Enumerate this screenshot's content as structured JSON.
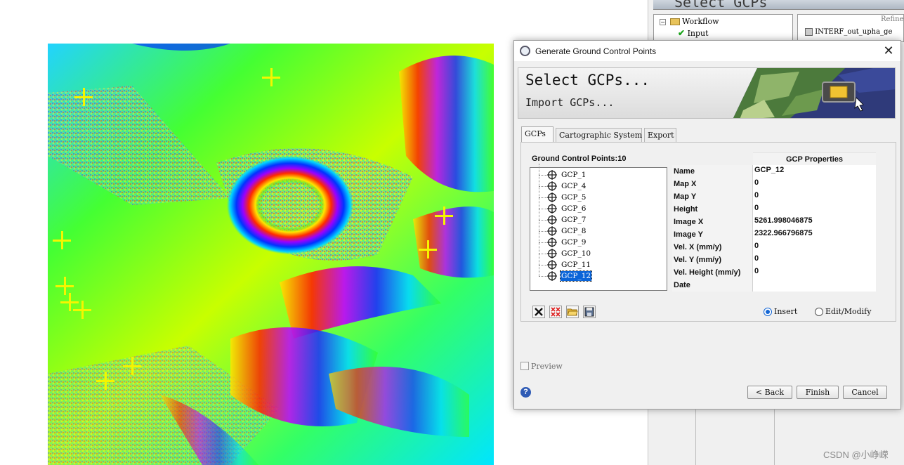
{
  "background_window": {
    "banner_text": "Select GCPs",
    "tree": [
      {
        "label": "Workflow"
      },
      {
        "label": "Input"
      }
    ],
    "list_header": "Refine",
    "list_item": "INTERF_out_upha_ge"
  },
  "dialog": {
    "title": "Generate Ground Control Points",
    "header": {
      "title": "Select GCPs...",
      "subtitle": "Import GCPs..."
    },
    "tabs": [
      {
        "label": "GCPs",
        "active": true
      },
      {
        "label": "Cartographic System",
        "active": false
      },
      {
        "label": "Export",
        "active": false
      }
    ],
    "gcp_panel": {
      "count_label": "Ground Control Points:",
      "count": "10",
      "items": [
        "GCP_1",
        "GCP_4",
        "GCP_5",
        "GCP_6",
        "GCP_7",
        "GCP_8",
        "GCP_9",
        "GCP_10",
        "GCP_11",
        "GCP_12"
      ],
      "selected": "GCP_12"
    },
    "properties": {
      "header": "GCP Properties",
      "rows": [
        {
          "key": "Name",
          "value": "GCP_12"
        },
        {
          "key": "Map X",
          "value": "0"
        },
        {
          "key": "Map Y",
          "value": "0"
        },
        {
          "key": "Height",
          "value": "0"
        },
        {
          "key": "Image X",
          "value": "5261.998046875"
        },
        {
          "key": "Image Y",
          "value": "2322.966796875"
        },
        {
          "key": "Vel. X (mm/y)",
          "value": "0"
        },
        {
          "key": "Vel. Y (mm/y)",
          "value": "0"
        },
        {
          "key": "Vel. Height (mm/y)",
          "value": "0"
        },
        {
          "key": "Date",
          "value": ""
        }
      ]
    },
    "toolbar_icons": [
      "delete-icon",
      "delete-all-icon",
      "open-folder-icon",
      "save-icon"
    ],
    "mode": {
      "insert_label": "Insert",
      "edit_label": "Edit/Modify",
      "selected": "Insert"
    },
    "preview_label": "Preview",
    "preview_checked": false,
    "buttons": {
      "back": "< Back",
      "finish": "Finish",
      "cancel": "Cancel"
    }
  },
  "watermark": "CSDN @小峥嵘",
  "colors": {
    "selection": "#0a64d8",
    "marker": "#f5f500"
  }
}
